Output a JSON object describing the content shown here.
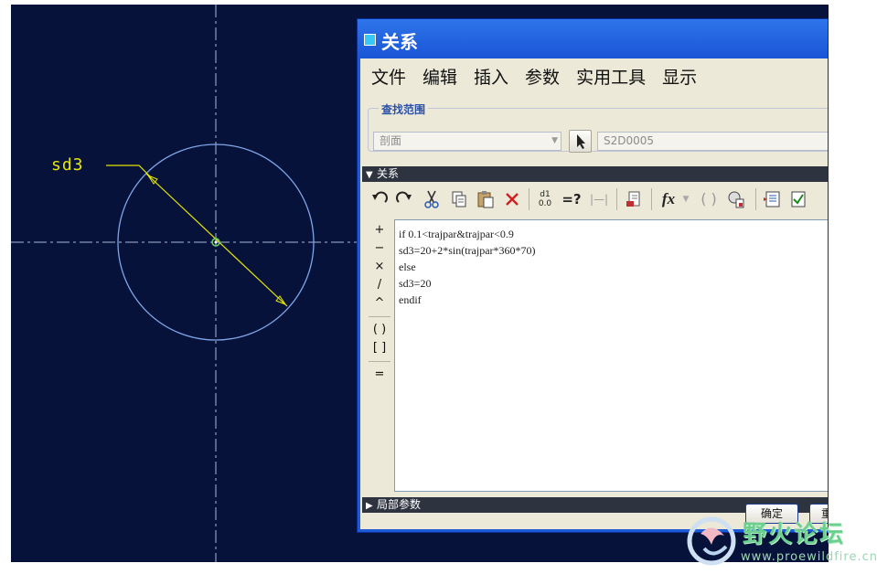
{
  "viewport": {
    "dimension_label": "sd3",
    "colors": {
      "background": "#06123a",
      "circle": "#7fa6e8",
      "dimension": "#e6e600",
      "axis": "#a8b8d8"
    }
  },
  "dialog": {
    "title": "关系",
    "menu": [
      "文件",
      "编辑",
      "插入",
      "参数",
      "实用工具",
      "显示"
    ],
    "search_scope": {
      "legend": "查找范围",
      "type_value": "剖面",
      "item_value": "S2D0005"
    },
    "relations_section": "关系",
    "toolbar_icons": [
      "undo-icon",
      "redo-icon",
      "cut-icon",
      "copy-icon",
      "paste-icon",
      "delete-icon",
      "switch-symbols-icon",
      "evaluate-icon",
      "measure-icon",
      "sort-icon",
      "function-icon",
      "parentheses-icon",
      "parameters-icon",
      "verify-icon",
      "check-icon"
    ],
    "toolbar_text": {
      "evaluate": "=?",
      "function": "fx",
      "measure": "|—|",
      "switch_top": "d1",
      "switch_bottom": "0.0"
    },
    "operators": [
      "+",
      "−",
      "×",
      "/",
      "^",
      "( )",
      "[ ]",
      "="
    ],
    "editor_lines": [
      "if 0.1<trajpar&trajpar<0.9",
      "sd3=20+2*sin(trajpar*360*70)",
      "else",
      "sd3=20",
      "endif"
    ],
    "local_params_section": "局部参数",
    "buttons": {
      "ok": "确定",
      "second": "重"
    },
    "colors": {
      "titlebar": "#1d5bd6",
      "client": "#ece9d8",
      "section_bar": "#2e3340"
    }
  },
  "watermark": {
    "text": "野火论坛",
    "url": "www.proewildfire.cn",
    "color": "#6dcf8f"
  }
}
